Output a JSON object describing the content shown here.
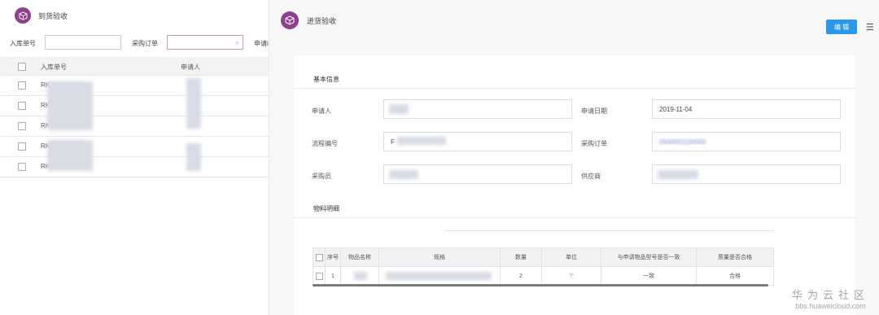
{
  "left_panel": {
    "title": "到货验收",
    "filters": {
      "receipt_no_label": "入库单号",
      "po_label": "采购订单",
      "applicant_label": "申请i"
    },
    "table": {
      "headers": [
        "入库单号",
        "申请人"
      ],
      "rows": [
        {
          "no": "RK"
        },
        {
          "no": "RK"
        },
        {
          "no": "RK"
        },
        {
          "no": "RK"
        },
        {
          "no": "RK"
        }
      ]
    }
  },
  "right_panel": {
    "title": "进货验收",
    "edit_label": "编 辑",
    "menu_icon": "list-icon",
    "basic_section": "基本信息",
    "fields": {
      "applicant_label": "申请人",
      "apply_date_label": "申请日期",
      "apply_date_value": "2019-11-04",
      "process_no_label": "流程编号",
      "process_no_value": "F",
      "po_label": "采购订单",
      "po_value": "0500001100000",
      "buyer_label": "采购员",
      "supplier_label": "供应商"
    },
    "materials_section": "物料明细",
    "materials_table": {
      "headers": [
        "序号",
        "物品名称",
        "规格",
        "数量",
        "单位",
        "与申请物品型号是否一致",
        "质量是否合格"
      ],
      "rows": [
        {
          "seq": "1",
          "qty": "2",
          "unit": "个",
          "consistent": "一致",
          "quality": "合格"
        }
      ]
    }
  },
  "watermark": {
    "cn": "华为云社区",
    "en": "bbs.huaweicloud.com"
  },
  "colors": {
    "accent": "#8e3f8e",
    "primary_button": "#2b97e9"
  }
}
